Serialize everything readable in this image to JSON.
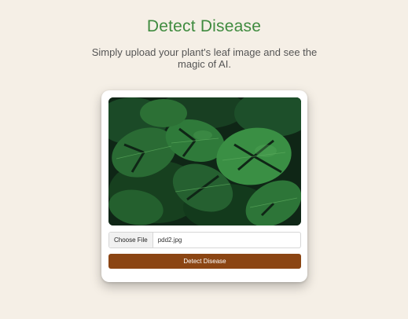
{
  "header": {
    "title": "Detect Disease",
    "subtitle": "Simply upload your plant's leaf image and see the magic of AI."
  },
  "upload": {
    "choose_file_label": "Choose File",
    "file_name": "pdd2.jpg"
  },
  "actions": {
    "detect_label": "Detect Disease"
  },
  "colors": {
    "background": "#f5efe6",
    "title": "#3f8b3f",
    "button": "#8b4513"
  }
}
